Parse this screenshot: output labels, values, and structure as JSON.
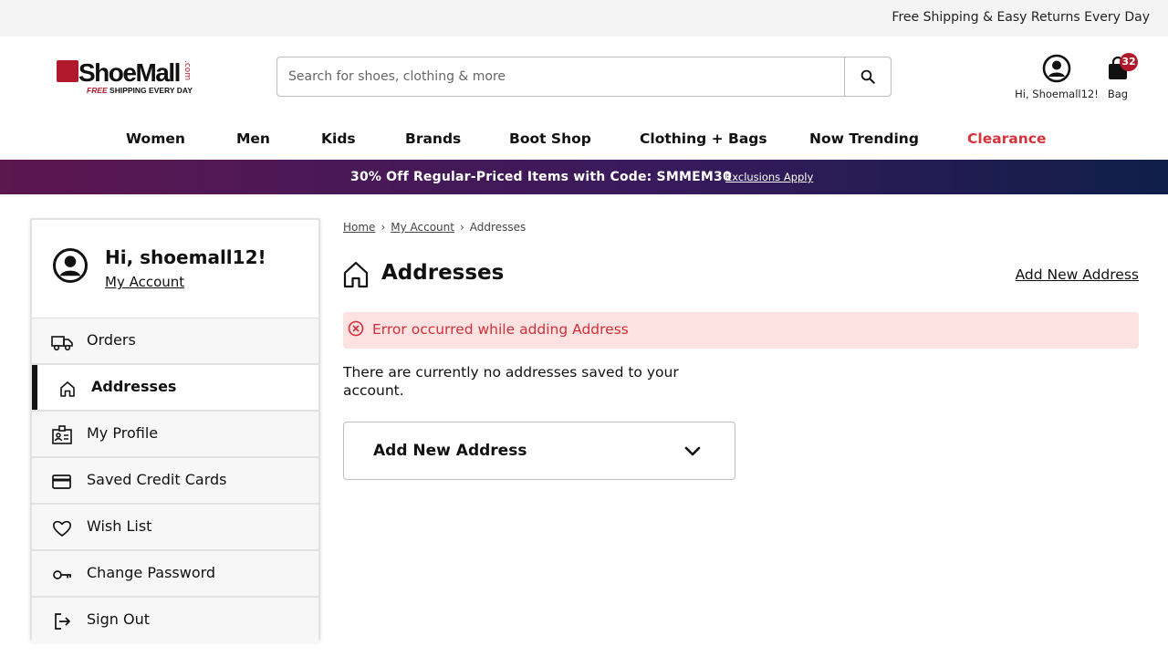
{
  "topbar": {
    "message": "Free Shipping & Easy Returns Every Day"
  },
  "logo": {
    "name": "ShoeMall",
    "domain": ".com",
    "tagline_red": "FREE",
    "tagline_rest": "SHIPPING EVERY DAY"
  },
  "search": {
    "placeholder": "Search for shoes, clothing & more",
    "value": ""
  },
  "account": {
    "greeting": "Hi, Shoemall12!"
  },
  "bag": {
    "label": "Bag",
    "count": "32"
  },
  "nav": {
    "items": [
      "Women",
      "Men",
      "Kids",
      "Brands",
      "Boot Shop",
      "Clothing + Bags",
      "Now Trending",
      "Clearance"
    ]
  },
  "promo": {
    "text": "30% Off Regular-Priced Items with Code: SMMEM30",
    "exclusions": "Exclusions Apply"
  },
  "sidebar": {
    "greeting": "Hi, shoemall12!",
    "my_account": "My Account",
    "items": [
      {
        "label": "Orders",
        "icon": "truck-icon"
      },
      {
        "label": "Addresses",
        "icon": "home-icon"
      },
      {
        "label": "My Profile",
        "icon": "id-card-icon"
      },
      {
        "label": "Saved Credit Cards",
        "icon": "credit-card-icon"
      },
      {
        "label": "Wish List",
        "icon": "heart-icon"
      },
      {
        "label": "Change Password",
        "icon": "key-icon"
      },
      {
        "label": "Sign Out",
        "icon": "sign-out-icon"
      }
    ],
    "active": "Addresses"
  },
  "breadcrumb": {
    "items": [
      "Home",
      "My Account",
      "Addresses"
    ]
  },
  "main": {
    "title": "Addresses",
    "add_link": "Add New Address",
    "error": "Error occurred while adding Address",
    "empty_text": "There are currently no addresses saved to your account.",
    "accordion_label": "Add New Address"
  },
  "colors": {
    "accent_red": "#d1303a",
    "brand_red": "#b0182b",
    "error_bg": "#fde2e2",
    "promo_start": "#5c1650",
    "promo_end": "#0f1e4a"
  }
}
